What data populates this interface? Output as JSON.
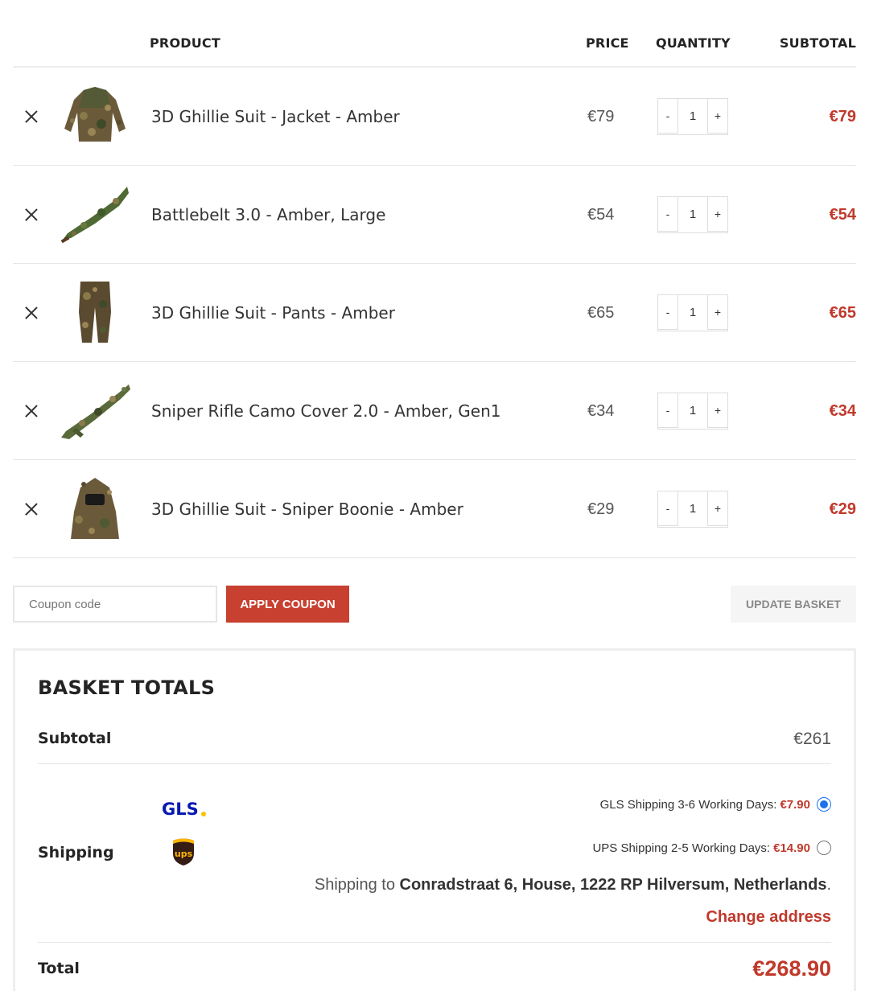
{
  "table": {
    "headers": {
      "product": "PRODUCT",
      "price": "PRICE",
      "quantity": "QUANTITY",
      "subtotal": "SUBTOTAL"
    },
    "items": [
      {
        "name": "3D Ghillie Suit - Jacket - Amber",
        "price": "€79",
        "qty": "1",
        "subtotal": "€79"
      },
      {
        "name": "Battlebelt 3.0 - Amber, Large",
        "price": "€54",
        "qty": "1",
        "subtotal": "€54"
      },
      {
        "name": "3D Ghillie Suit - Pants - Amber",
        "price": "€65",
        "qty": "1",
        "subtotal": "€65"
      },
      {
        "name": "Sniper Rifle Camo Cover 2.0 - Amber, Gen1",
        "price": "€34",
        "qty": "1",
        "subtotal": "€34"
      },
      {
        "name": "3D Ghillie Suit - Sniper Boonie - Amber",
        "price": "€29",
        "qty": "1",
        "subtotal": "€29"
      }
    ],
    "minus_label": "-",
    "plus_label": "+"
  },
  "actions": {
    "coupon_placeholder": "Coupon code",
    "apply_label": "APPLY COUPON",
    "update_label": "UPDATE BASKET"
  },
  "totals": {
    "title": "BASKET TOTALS",
    "subtotal_label": "Subtotal",
    "subtotal_value": "€261",
    "shipping_label": "Shipping",
    "gls_logo_text": "GLS",
    "ups_logo_text": "ups",
    "options": [
      {
        "label": "GLS Shipping 3-6 Working Days:",
        "cost": "€7.90",
        "selected": true
      },
      {
        "label": "UPS Shipping 2-5 Working Days:",
        "cost": "€14.90",
        "selected": false
      }
    ],
    "shipping_to_prefix": "Shipping to",
    "shipping_address": "Conradstraat 6, House, 1222 RP Hilversum, Netherlands",
    "shipping_to_suffix": ".",
    "change_address": "Change address",
    "total_label": "Total",
    "total_value": "€268.90"
  },
  "colors": {
    "accent": "#c8402f",
    "price_red": "#c0392b",
    "radio_blue": "#1a73e8",
    "gls_blue": "#061ab1",
    "gls_yellow": "#f5c400",
    "ups_brown": "#351c15",
    "ups_gold": "#ffb500"
  }
}
